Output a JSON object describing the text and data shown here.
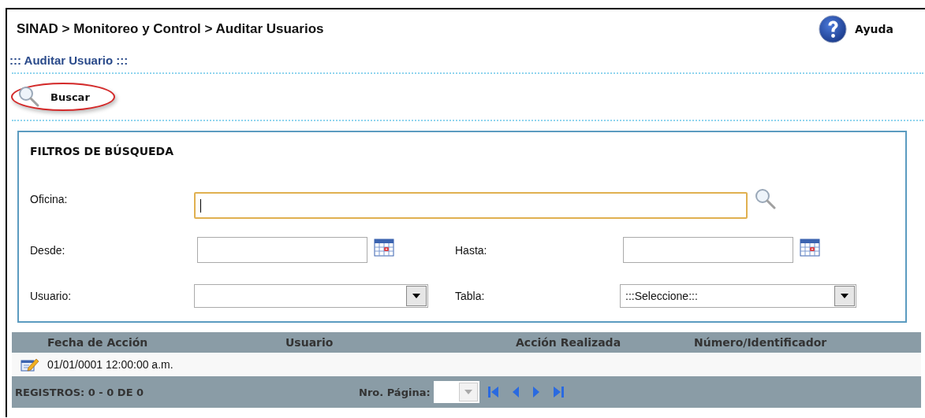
{
  "breadcrumb": "SINAD > Monitoreo y Control > Auditar Usuarios",
  "help": {
    "label": "Ayuda"
  },
  "section_title": "::: Auditar Usuario :::",
  "toolbar": {
    "button": {
      "label": "Buscar",
      "highlighted": true
    }
  },
  "filters": {
    "title": "FILTROS DE BÚSQUEDA",
    "rows": [
      {
        "fields": [
          {
            "kind": "lookup",
            "label": "Oficina:",
            "focused": true
          }
        ]
      },
      {
        "fields": [
          {
            "kind": "date",
            "label": "Desde:",
            "focused": false
          },
          {
            "kind": "date",
            "label": "Hasta:",
            "focused": false
          }
        ]
      },
      {
        "fields": [
          {
            "kind": "select",
            "label": "Usuario:",
            "focused": false
          },
          {
            "kind": "select",
            "label": "Tabla:",
            "value": ":::Seleccione:::",
            "focused": false
          }
        ]
      }
    ]
  },
  "table": {
    "columns": [
      "Fecha de Acción",
      "Usuario",
      "Acción Realizada",
      "Número/Identificador"
    ],
    "rows": [
      {
        "cells": [
          "01/01/0001 12:00:00 a.m.",
          "",
          "",
          ""
        ]
      }
    ]
  },
  "footer": {
    "records": "REGISTROS: 0 - 0 DE 0",
    "page_label": "Nro. Página:",
    "page_select": {
      "disabled": true
    }
  }
}
